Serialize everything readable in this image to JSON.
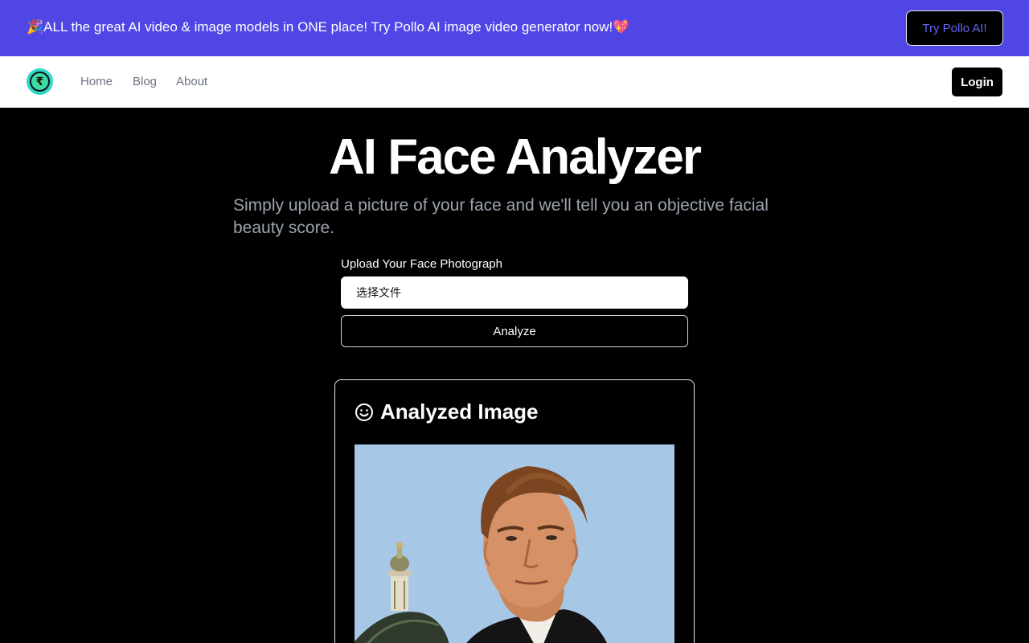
{
  "promo": {
    "text": "🎉ALL the great AI video & image models in ONE place! Try Pollo AI image video generator now!💖",
    "cta_label": "Try Pollo AI!"
  },
  "nav": {
    "logo_glyph": "₹",
    "links": [
      "Home",
      "Blog",
      "About"
    ],
    "login_label": "Login"
  },
  "hero": {
    "title": "AI Face Analyzer",
    "subtitle": "Simply upload a picture of your face and we'll tell you an objective facial beauty score."
  },
  "form": {
    "upload_label": "Upload Your Face Photograph",
    "file_button_label": "选择文件",
    "analyze_label": "Analyze"
  },
  "result": {
    "title": "Analyzed Image",
    "icon": "smile-icon"
  },
  "colors": {
    "promo_bg": "#4f46e5",
    "accent": "#6366f1",
    "background": "#000000"
  }
}
